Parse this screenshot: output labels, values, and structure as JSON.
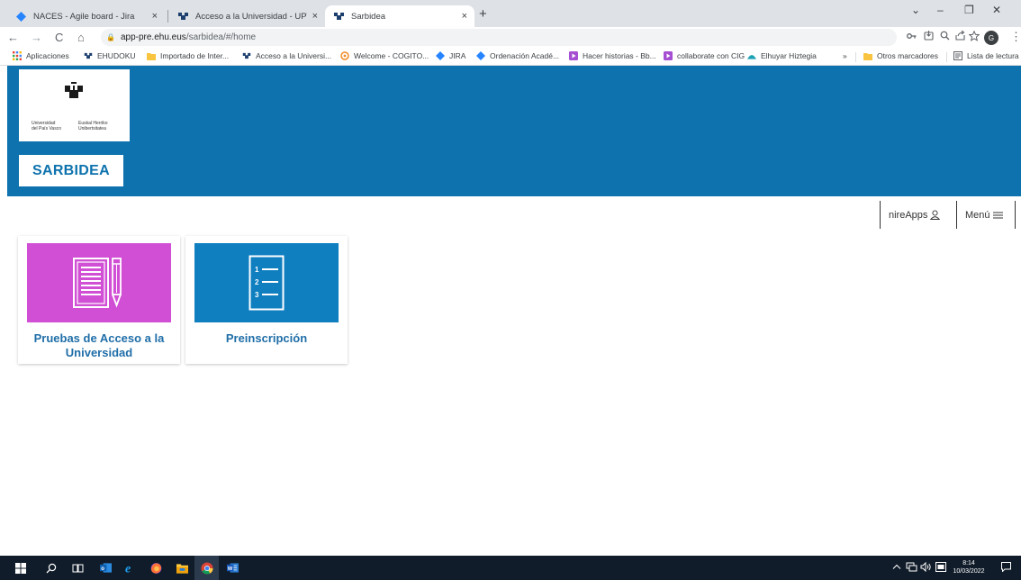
{
  "tabs": [
    {
      "title": "NACES - Agile board - Jira",
      "close": "×"
    },
    {
      "title": "Acceso a la Universidad - UPV/EH",
      "close": "×"
    },
    {
      "title": "Sarbidea",
      "close": "×"
    }
  ],
  "new_tab": "+",
  "window_controls": {
    "dropdown": "⌄",
    "minimize": "–",
    "restore": "❐",
    "close": "✕"
  },
  "toolbar": {
    "back": "←",
    "forward": "→",
    "reload": "C",
    "home": "⌂",
    "url_host": "app-pre.ehu.eus",
    "url_path": "/sarbidea/#/home",
    "profile_initial": "G",
    "more": "⋮"
  },
  "bookmarks": [
    {
      "label": "Aplicaciones",
      "icon": "apps-grid-icon"
    },
    {
      "label": "EHUDOKU",
      "icon": "upv-logo-icon"
    },
    {
      "label": "Importado de Inter...",
      "icon": "folder-icon"
    },
    {
      "label": "Acceso a la Universi...",
      "icon": "upv-logo-icon"
    },
    {
      "label": "Welcome - COGITO...",
      "icon": "cogito-icon"
    },
    {
      "label": "JIRA",
      "icon": "jira-icon"
    },
    {
      "label": "Ordenación Acadé...",
      "icon": "jira-icon"
    },
    {
      "label": "Hacer historias - Bb...",
      "icon": "play-icon"
    },
    {
      "label": "collaborate con CIG",
      "icon": "play-icon"
    },
    {
      "label": "Elhuyar Hiztegia",
      "icon": "elhuyar-icon"
    }
  ],
  "bookmarks_more": "»",
  "bookmarks_other": "Otros marcadores",
  "bookmarks_reading": "Lista de lectura",
  "header": {
    "logo_line1": "Universidad\ndel País Vasco",
    "logo_line2": "Euskal Herriko\nUnibertsitatea",
    "brand": "SARBIDEA",
    "accent": "#0d72ad"
  },
  "nav": {
    "apps_label": "nireApps",
    "menu_label": "Menú"
  },
  "cards": [
    {
      "label": "Pruebas de Acceso a la Universidad",
      "color": "#d14fd4",
      "icon": "document-pencil-icon"
    },
    {
      "label": "Preinscripción",
      "color": "#0f7fc0",
      "icon": "numbered-list-icon"
    }
  ],
  "taskbar": {
    "time": "8:14",
    "date": "10/03/2022"
  }
}
